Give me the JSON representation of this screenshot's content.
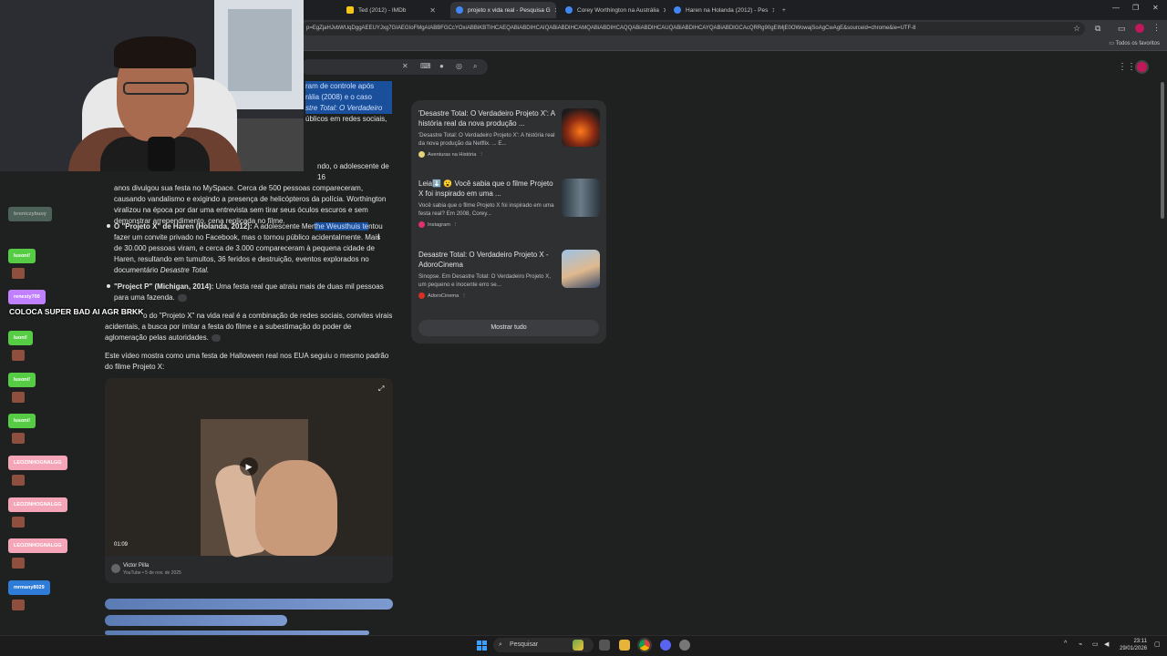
{
  "browser": {
    "tabs": [
      {
        "label": "Ted (2012) - IMDb",
        "favicon_color": "#f5c518"
      },
      {
        "label": "projeto x vida real - Pesquisa G",
        "favicon_color": "#4285f4"
      },
      {
        "label": "Corey Worthington na Austrália",
        "favicon_color": "#4285f4"
      },
      {
        "label": "Haren na Holanda (2012) - Pes",
        "favicon_color": "#4285f4"
      }
    ],
    "new_tab_label": "+",
    "url": "p=EgZjaHJvbWUqDggAEEUYJxg7GIAEGIoFMgAIABBFGCcYOxiABBiKBTIHCAEQABiABDIHCAIQABiABDIHCAMQABiABDIHCAQQABiABDIHCAUQABiABDIHCAYQABiABDIGCAcQRRg90gEIMjE0OWowajSoAgCwAgE&sourceid=chrome&ie=UTF-8",
    "bookmarks_label": "Todos os favoritos"
  },
  "answer": {
    "top_lines": [
      "ram de controle após",
      "rália (2008) e o caso",
      "stre Total: O Verdadeiro",
      "úblicos em redes sociais,"
    ],
    "corey_lines": [
      "ndo, o adolescente de 16",
      "anos divulgou sua festa no MySpace. Cerca de 500 pessoas compareceram,",
      "causando vandalismo e exigindo a presença de helicópteros da polícia. Worthington",
      "viralizou na época por dar uma entrevista sem tirar seus óculos escuros e sem",
      "demonstrar arrependimento, cena replicada no filme."
    ],
    "haren": {
      "bold": "O \"Projeto X\" de Haren (Holanda, 2012):",
      "pre": " A adolescente Mer",
      "highlight": "the Weusthuis te",
      "post": "ntou",
      "lines": [
        "fazer um convite privado no Facebook, mas o tornou público acidentalmente. Mais",
        "de 30.000 pessoas viram, e cerca de 3.000 compareceram à pequena cidade de",
        "Haren, resultando em tumultos, 36 feridos e destruição, eventos explorados no"
      ],
      "last_pre": "documentário ",
      "last_italic": "Desastre Total."
    },
    "projectp": {
      "bold": "\"Project P\" (Michigan, 2014):",
      "text": " Uma festa real que atraiu mais de duas mil pessoas",
      "line2": "para uma fazenda."
    },
    "summary_lines": [
      "o do \"Projeto X\" na vida real é a combinação de redes sociais, convites virais",
      "acidentais, a busca por imitar a festa do filme e a subestimação do poder de",
      "aglomeração pelas autoridades."
    ],
    "video_intro": [
      "Este vídeo mostra como uma festa de Halloween real nos EUA seguiu o mesmo padrão",
      "do filme Projeto X:"
    ]
  },
  "video": {
    "duration": "01:09",
    "channel": "Victor Pilla",
    "meta": "YouTube • 5 de nov. de 2025"
  },
  "sources": [
    {
      "title": "'Desastre Total: O Verdadeiro Projeto X': A história real da nova produção ...",
      "snippet": "'Desastre Total: O Verdadeiro Projeto X': A história real da nova produção da Netflix. ... E...",
      "site": "Aventuras na História",
      "site_color": "#e8d27a",
      "thumb_color": "#8a2a12"
    },
    {
      "title": "Leia⬇️ 😮 Você sabia que o filme Projeto X foi inspirado em uma ...",
      "snippet": "Você sabia que o filme Projeto X foi inspirado em uma festa real? Em 2008, Corey...",
      "site": "Instagram",
      "site_color": "#e1306c",
      "thumb_color": "#3c4a55"
    },
    {
      "title": "Desastre Total: O Verdadeiro Projeto X - AdoroCinema",
      "snippet": "Sinopse. Em Desastre Total: O Verdadeiro Projeto X, um pequeno e inocente erro se...",
      "site": "AdoroCinema",
      "site_color": "#d93025",
      "thumb_color": "#7fa3c6"
    }
  ],
  "show_all_label": "Mostrar tudo",
  "chat": {
    "badges": [
      {
        "name": "broniczybuoy",
        "color": "#6b8f80"
      },
      {
        "name": "lusoni!",
        "color": "#55cc44"
      },
      {
        "name": "renesty700",
        "color": "#c080ff"
      },
      {
        "name": "luoni!",
        "color": "#55cc44"
      },
      {
        "name": "lusoni!",
        "color": "#55cc44"
      },
      {
        "name": "lusoni!",
        "color": "#55cc44"
      },
      {
        "name": "LEOZINHOGNALGG",
        "color": "#f4a6b8"
      },
      {
        "name": "LEOZINHOGNALGG",
        "color": "#f4a6b8"
      },
      {
        "name": "LEOZINHOGNALGG",
        "color": "#f4a6b8"
      },
      {
        "name": "mrmany8029",
        "color": "#2f7bd8"
      }
    ],
    "message": "COLOCA SUPER BAD AI AGR BRKK"
  },
  "taskbar": {
    "search_label": "Pesquisar",
    "time": "23:11",
    "date": "29/01/2026"
  }
}
